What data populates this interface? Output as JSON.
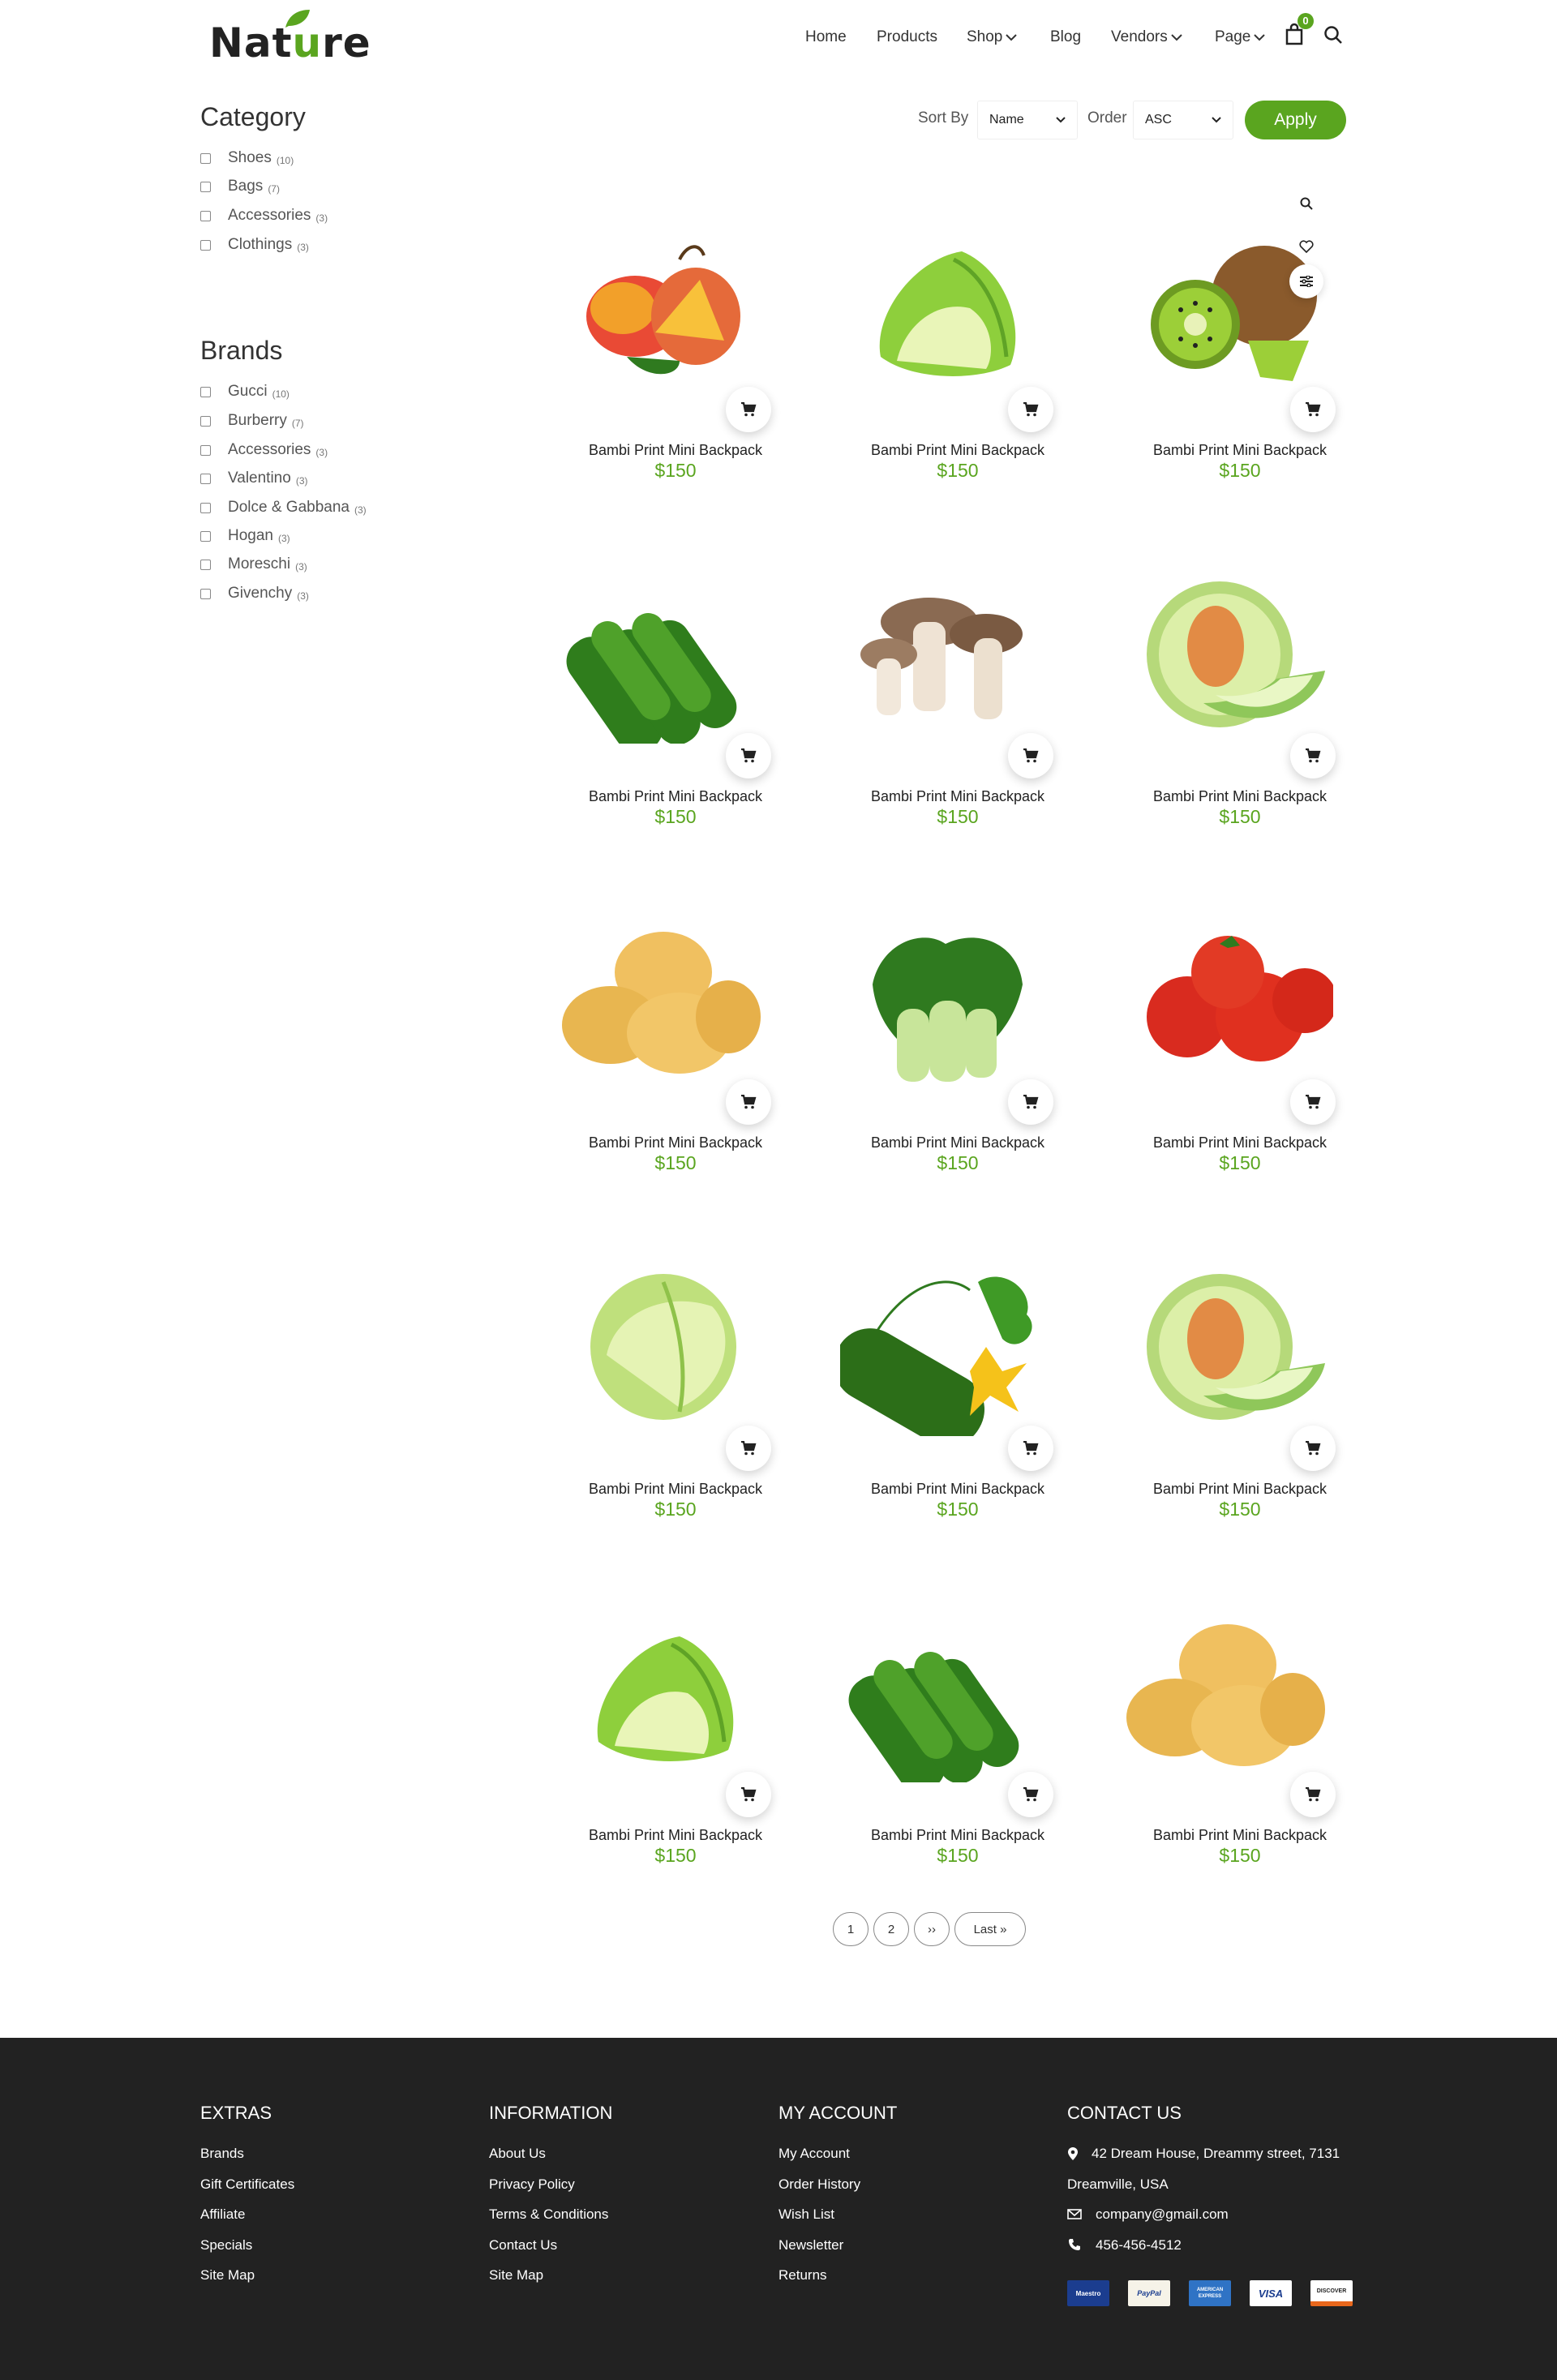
{
  "header": {
    "logo_pre": "Nat",
    "logo_u": "u",
    "logo_post": "re",
    "nav": [
      "Home",
      "Products",
      "Shop",
      "Blog",
      "Vendors",
      "Page"
    ],
    "cart_count": "0",
    "icons": [
      "shopping-bag-icon",
      "search-icon"
    ]
  },
  "sidebar": {
    "category_title": "Category",
    "categories": [
      {
        "label": "Shoes",
        "count": "(10)"
      },
      {
        "label": "Bags",
        "count": "(7)"
      },
      {
        "label": "Accessories",
        "count": "(3)"
      },
      {
        "label": "Clothings",
        "count": "(3)"
      }
    ],
    "brands_title": "Brands",
    "brands": [
      {
        "label": "Gucci",
        "count": "(10)"
      },
      {
        "label": "Burberry",
        "count": "(7)"
      },
      {
        "label": "Accessories",
        "count": "(3)"
      },
      {
        "label": "Valentino",
        "count": "(3)"
      },
      {
        "label": "Dolce & Gabbana",
        "count": "(3)"
      },
      {
        "label": "Hogan",
        "count": "(3)"
      },
      {
        "label": "Moreschi",
        "count": "(3)"
      },
      {
        "label": "Givenchy",
        "count": "(3)"
      }
    ]
  },
  "toolbar": {
    "sort_label": "Sort By",
    "sort_value": "Name",
    "order_label": "Order",
    "order_value": "ASC",
    "apply_label": "Apply"
  },
  "quick_icons": [
    "search-icon",
    "heart-icon",
    "compare-icon"
  ],
  "products": [
    {
      "name": "Bambi Print Mini Backpack",
      "price": "$150",
      "image": "mango"
    },
    {
      "name": "Bambi Print Mini Backpack",
      "price": "$150",
      "image": "napa-cabbage"
    },
    {
      "name": "Bambi Print Mini Backpack",
      "price": "$150",
      "image": "kiwi"
    },
    {
      "name": "Bambi Print Mini Backpack",
      "price": "$150",
      "image": "cucumbers"
    },
    {
      "name": "Bambi Print Mini Backpack",
      "price": "$150",
      "image": "mushrooms"
    },
    {
      "name": "Bambi Print Mini Backpack",
      "price": "$150",
      "image": "melon"
    },
    {
      "name": "Bambi Print Mini Backpack",
      "price": "$150",
      "image": "potatoes"
    },
    {
      "name": "Bambi Print Mini Backpack",
      "price": "$150",
      "image": "bok-choy"
    },
    {
      "name": "Bambi Print Mini Backpack",
      "price": "$150",
      "image": "tomatoes"
    },
    {
      "name": "Bambi Print Mini Backpack",
      "price": "$150",
      "image": "cabbage"
    },
    {
      "name": "Bambi Print Mini Backpack",
      "price": "$150",
      "image": "cucumber-flower"
    },
    {
      "name": "Bambi Print Mini Backpack",
      "price": "$150",
      "image": "melon"
    },
    {
      "name": "Bambi Print Mini Backpack",
      "price": "$150",
      "image": "napa-cabbage"
    },
    {
      "name": "Bambi Print Mini Backpack",
      "price": "$150",
      "image": "cucumbers"
    },
    {
      "name": "Bambi Print Mini Backpack",
      "price": "$150",
      "image": "potatoes"
    }
  ],
  "pagination": [
    "1",
    "2",
    "››",
    "Last »"
  ],
  "footer": {
    "extras": {
      "title": "EXTRAS",
      "links": [
        "Brands",
        "Gift Certificates",
        "Affiliate",
        "Specials",
        "Site Map"
      ]
    },
    "information": {
      "title": "INFORMATION",
      "links": [
        "About Us",
        "Privacy Policy",
        "Terms & Conditions",
        "Contact Us",
        "Site Map"
      ]
    },
    "account": {
      "title": "MY ACCOUNT",
      "links": [
        "My Account",
        "Order History",
        "Wish List",
        "Newsletter",
        "Returns"
      ]
    },
    "contact": {
      "title": "CONTACT US",
      "address_line1": "42 Dream House, Dreammy street, 7131",
      "address_line2": "Dreamville, USA",
      "email": "company@gmail.com",
      "phone": "456-456-4512"
    },
    "payments": [
      "Maestro",
      "PayPal",
      "AMERICAN EXPRESS",
      "VISA",
      "DISCOVER"
    ]
  },
  "colors": {
    "accent": "#5aa51f",
    "footer_bg": "#222222"
  }
}
